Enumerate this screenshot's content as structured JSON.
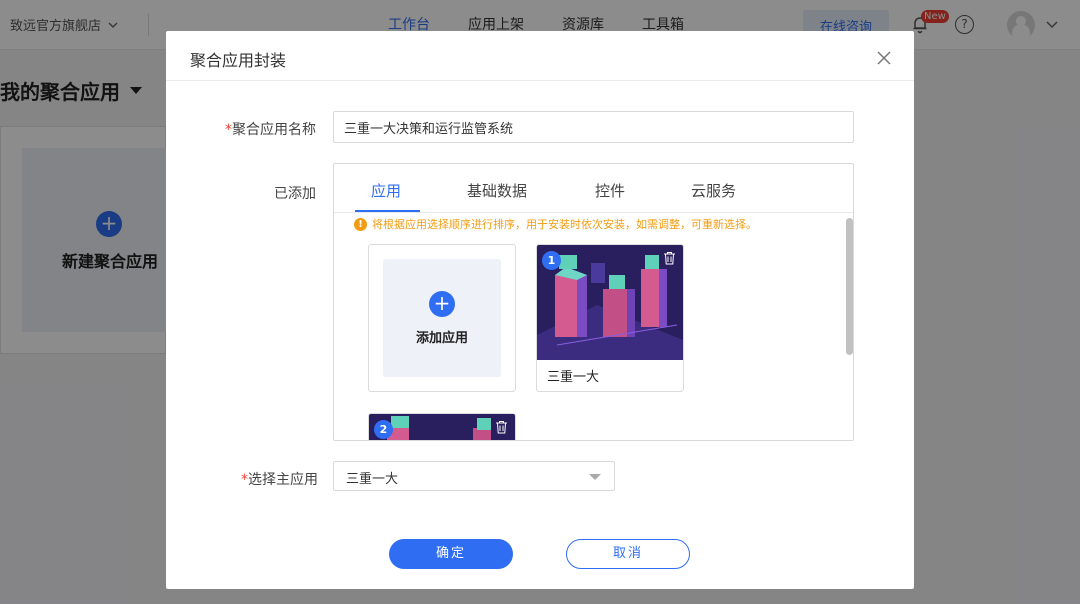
{
  "topnav": {
    "store_name": "致远官方旗舰店",
    "items": [
      "工作台",
      "应用上架",
      "资源库",
      "工具箱"
    ],
    "active_index": 0,
    "consult_label": "在线咨询",
    "new_badge": "New",
    "help_glyph": "?"
  },
  "page": {
    "title": "我的聚合应用",
    "new_app_label": "新建聚合应用"
  },
  "modal": {
    "title": "聚合应用封装",
    "name_label": "聚合应用名称",
    "name_value": "三重一大决策和运行监管系统",
    "added_label": "已添加",
    "tabs": [
      "应用",
      "基础数据",
      "控件",
      "云服务"
    ],
    "active_tab": 0,
    "notice": "将根据应用选择顺序进行排序，用于安装时依次安装，如需调整，可重新选择。",
    "add_app_label": "添加应用",
    "apps": [
      {
        "index": "1",
        "name": "三重一大"
      },
      {
        "index": "2",
        "name": ""
      }
    ],
    "main_app_label": "选择主应用",
    "main_app_value": "三重一大",
    "required_mark": "*",
    "ok_label": "确定",
    "cancel_label": "取消"
  },
  "colors": {
    "accent": "#2f6ef2",
    "warning": "#f39c12",
    "required": "#f04134"
  }
}
